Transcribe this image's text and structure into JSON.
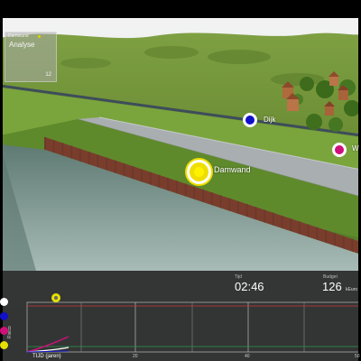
{
  "analysis_panel": {
    "tag": "Damwand",
    "title": "Analyse",
    "value": "12"
  },
  "markers": [
    {
      "label": "Dijk",
      "color": "#1010c8"
    },
    {
      "label": "W",
      "color": "#d0107a"
    },
    {
      "label": "Damwand",
      "color": "#f0de00"
    }
  ],
  "stats": {
    "time_caption": "Tijd",
    "time_value": "02:46",
    "budget_caption": "Budget",
    "budget_value": "126",
    "budget_unit": "kEuro"
  },
  "chart": {
    "y_label": "Risico",
    "x_label": "TIJD (jaren)",
    "x_ticks": [
      "20",
      "40",
      "50"
    ],
    "legend_colors": [
      "#ffffff",
      "#1010c8",
      "#d0107a",
      "#e6e000"
    ]
  }
}
